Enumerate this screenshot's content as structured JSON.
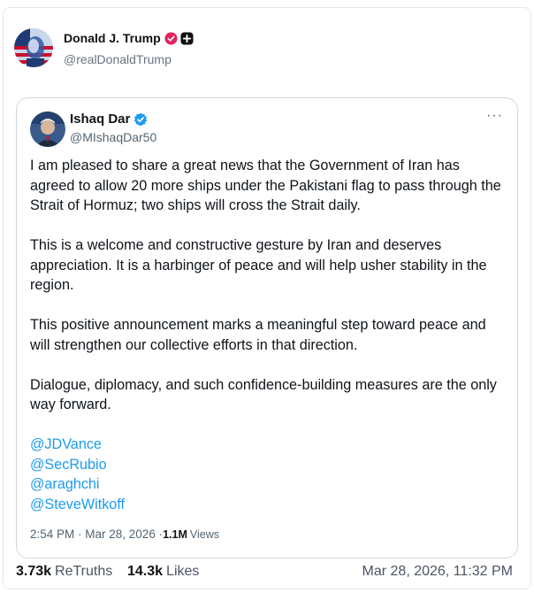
{
  "post": {
    "author_name": "Donald J. Trump",
    "author_handle": "@realDonaldTrump",
    "verified_badge_icon": "verified-badge-icon",
    "plus_badge_icon": "plus-badge-icon",
    "accent_color": "#e0245e"
  },
  "quoted_post": {
    "author_name": "Ishaq Dar",
    "author_handle": "@MIshaqDar50",
    "more_icon": "···",
    "paragraphs": [
      "I am pleased to share a great news that the Government of Iran has agreed to allow 20 more ships under the Pakistani flag to pass through the Strait of Hormuz; two ships will cross the Strait daily.",
      "This is a welcome and constructive gesture by Iran and deserves appreciation. It is a harbinger of peace and will help usher stability in the region.",
      "This positive announcement marks a meaningful step toward peace and will strengthen our collective efforts in that direction.",
      "Dialogue, diplomacy, and such confidence-building measures are the only way forward."
    ],
    "mentions": [
      "@JDVance",
      "@SecRubio",
      "@araghchi",
      "@SteveWitkoff"
    ],
    "timestamp": "2:54 PM · Mar 28, 2026 · ",
    "views_count": "1.1M",
    "views_label": "Views",
    "link_color": "#1d9bf0",
    "verified_color": "#1d9bf0"
  },
  "footer": {
    "retruths_count": "3.73k",
    "retruths_label": "ReTruths",
    "likes_count": "14.3k",
    "likes_label": "Likes",
    "date": "Mar 28, 2026, 11:32 PM"
  }
}
